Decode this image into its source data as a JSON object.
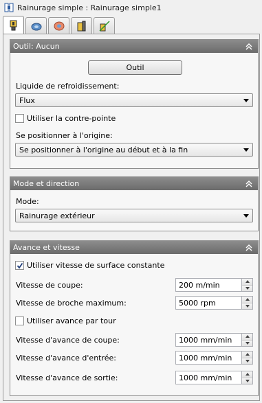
{
  "window": {
    "title": "Rainurage simple : Rainurage simple1"
  },
  "tabs": [
    {
      "icon": "tool-icon",
      "active": true
    },
    {
      "icon": "coolant-icon",
      "active": false
    },
    {
      "icon": "passes-icon",
      "active": false
    },
    {
      "icon": "linking-icon",
      "active": false
    },
    {
      "icon": "toolpath-icon",
      "active": false
    }
  ],
  "tool_section": {
    "title": "Outil: Aucun",
    "tool_button": "Outil",
    "coolant_label": "Liquide de refroidissement:",
    "coolant_value": "Flux",
    "tailstock_label": "Utiliser la contre-pointe",
    "tailstock_checked": false,
    "home_label": "Se positionner à l'origine:",
    "home_value": "Se positionner à l'origine au début et à la fin"
  },
  "mode_section": {
    "title": "Mode et direction",
    "mode_label": "Mode:",
    "mode_value": "Rainurage extérieur"
  },
  "feed_section": {
    "title": "Avance et vitesse",
    "css_label": "Utiliser vitesse de surface constante",
    "css_checked": true,
    "cutting_speed_label": "Vitesse de coupe:",
    "cutting_speed_value": "200 m/min",
    "max_spindle_label": "Vitesse de broche maximum:",
    "max_spindle_value": "5000 rpm",
    "feed_per_rev_label": "Utiliser avance par tour",
    "feed_per_rev_checked": false,
    "cutting_feed_label": "Vitesse d'avance de coupe:",
    "cutting_feed_value": "1000 mm/min",
    "entry_feed_label": "Vitesse d'avance d'entrée:",
    "entry_feed_value": "1000 mm/min",
    "exit_feed_label": "Vitesse d'avance de sortie:",
    "exit_feed_value": "1000 mm/min"
  }
}
